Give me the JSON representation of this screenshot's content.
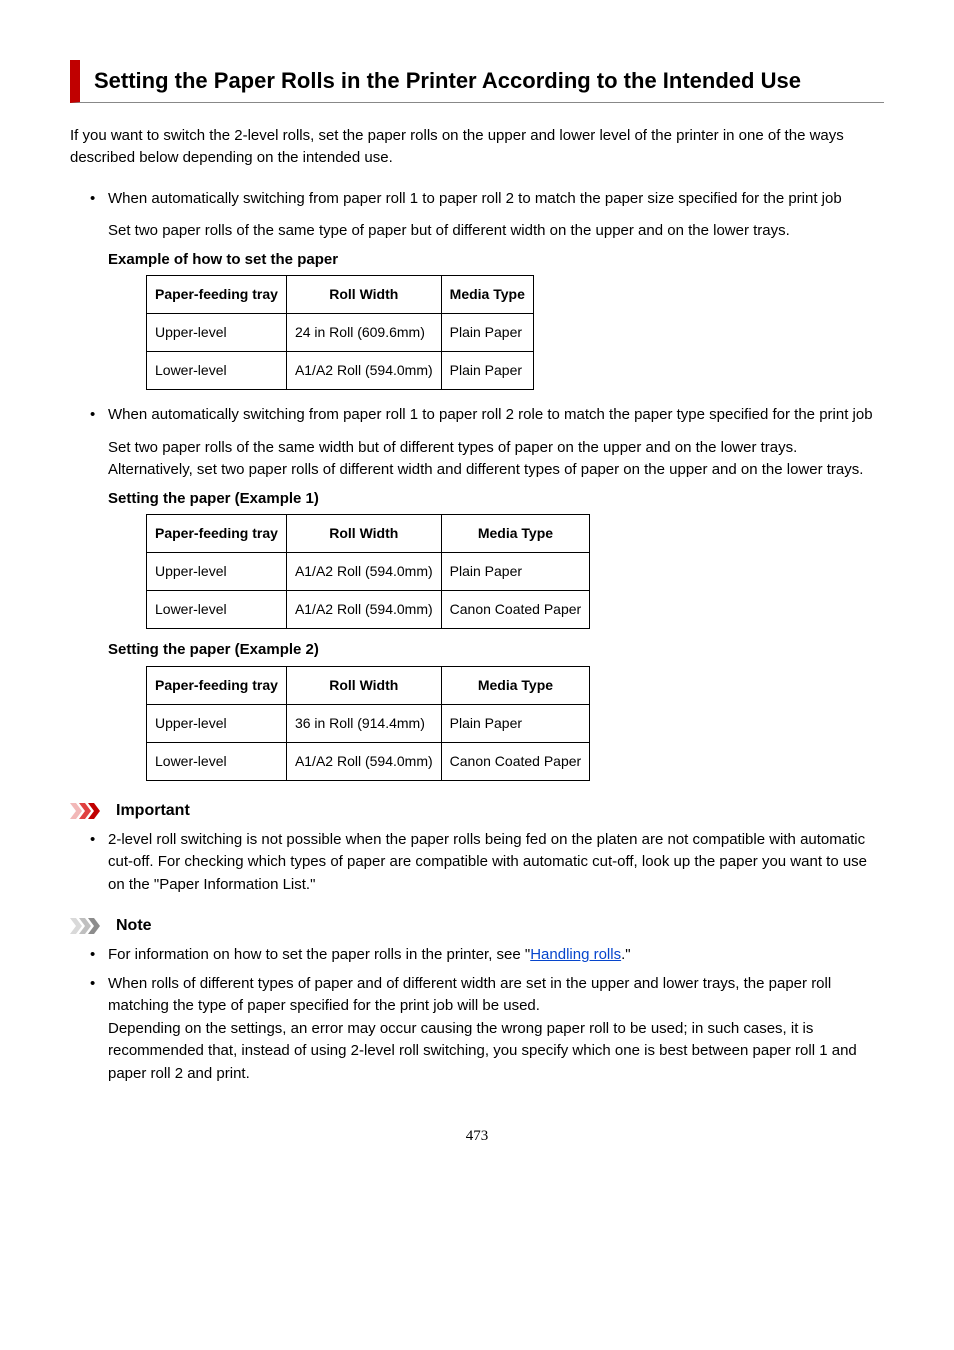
{
  "heading": "Setting the Paper Rolls in the Printer According to the Intended Use",
  "intro": "If you want to switch the 2-level rolls, set the paper rolls on the upper and lower level of the printer in one of the ways described below depending on the intended use.",
  "bullet1": {
    "lead": "When automatically switching from paper roll 1 to paper roll 2 to match the paper size specified for the print job",
    "detail": "Set two paper rolls of the same type of paper but of different width on the upper and on the lower trays.",
    "table_title": "Example of how to set the paper",
    "table": {
      "headers": [
        "Paper-feeding tray",
        "Roll Width",
        "Media Type"
      ],
      "rows": [
        [
          "Upper-level",
          "24 in Roll (609.6mm)",
          "Plain Paper"
        ],
        [
          "Lower-level",
          "A1/A2 Roll (594.0mm)",
          "Plain Paper"
        ]
      ]
    }
  },
  "bullet2": {
    "lead": "When automatically switching from paper roll 1 to paper roll 2 role to match the paper type specified for the print job",
    "detail": "Set two paper rolls of the same width but of different types of paper on the upper and on the lower trays. Alternatively, set two paper rolls of different width and different types of paper on the upper and on the lower trays.",
    "table1_title": "Setting the paper (Example 1)",
    "table1": {
      "headers": [
        "Paper-feeding tray",
        "Roll Width",
        "Media Type"
      ],
      "rows": [
        [
          "Upper-level",
          "A1/A2 Roll (594.0mm)",
          "Plain Paper"
        ],
        [
          "Lower-level",
          "A1/A2 Roll (594.0mm)",
          "Canon Coated Paper"
        ]
      ]
    },
    "table2_title": "Setting the paper (Example 2)",
    "table2": {
      "headers": [
        "Paper-feeding tray",
        "Roll Width",
        "Media Type"
      ],
      "rows": [
        [
          "Upper-level",
          "36 in Roll (914.4mm)",
          "Plain Paper"
        ],
        [
          "Lower-level",
          "A1/A2 Roll (594.0mm)",
          "Canon Coated Paper"
        ]
      ]
    }
  },
  "important": {
    "label": "Important",
    "items": [
      "2-level roll switching is not possible when the paper rolls being fed on the platen are not compatible with automatic cut-off. For checking which types of paper are compatible with automatic cut-off, look up the paper you want to use on the \"Paper Information List.\""
    ]
  },
  "note": {
    "label": "Note",
    "item1_pre": "For information on how to set the paper rolls in the printer, see \"",
    "item1_link": "Handling rolls",
    "item1_post": ".\"",
    "item2_p1": "When rolls of different types of paper and of different width are set in the upper and lower trays, the paper roll matching the type of paper specified for the print job will be used.",
    "item2_p2": "Depending on the settings, an error may occur causing the wrong paper roll to be used; in such cases, it is recommended that, instead of using 2-level roll switching, you specify which one is best between paper roll 1 and paper roll 2 and print."
  },
  "page_number": "473"
}
